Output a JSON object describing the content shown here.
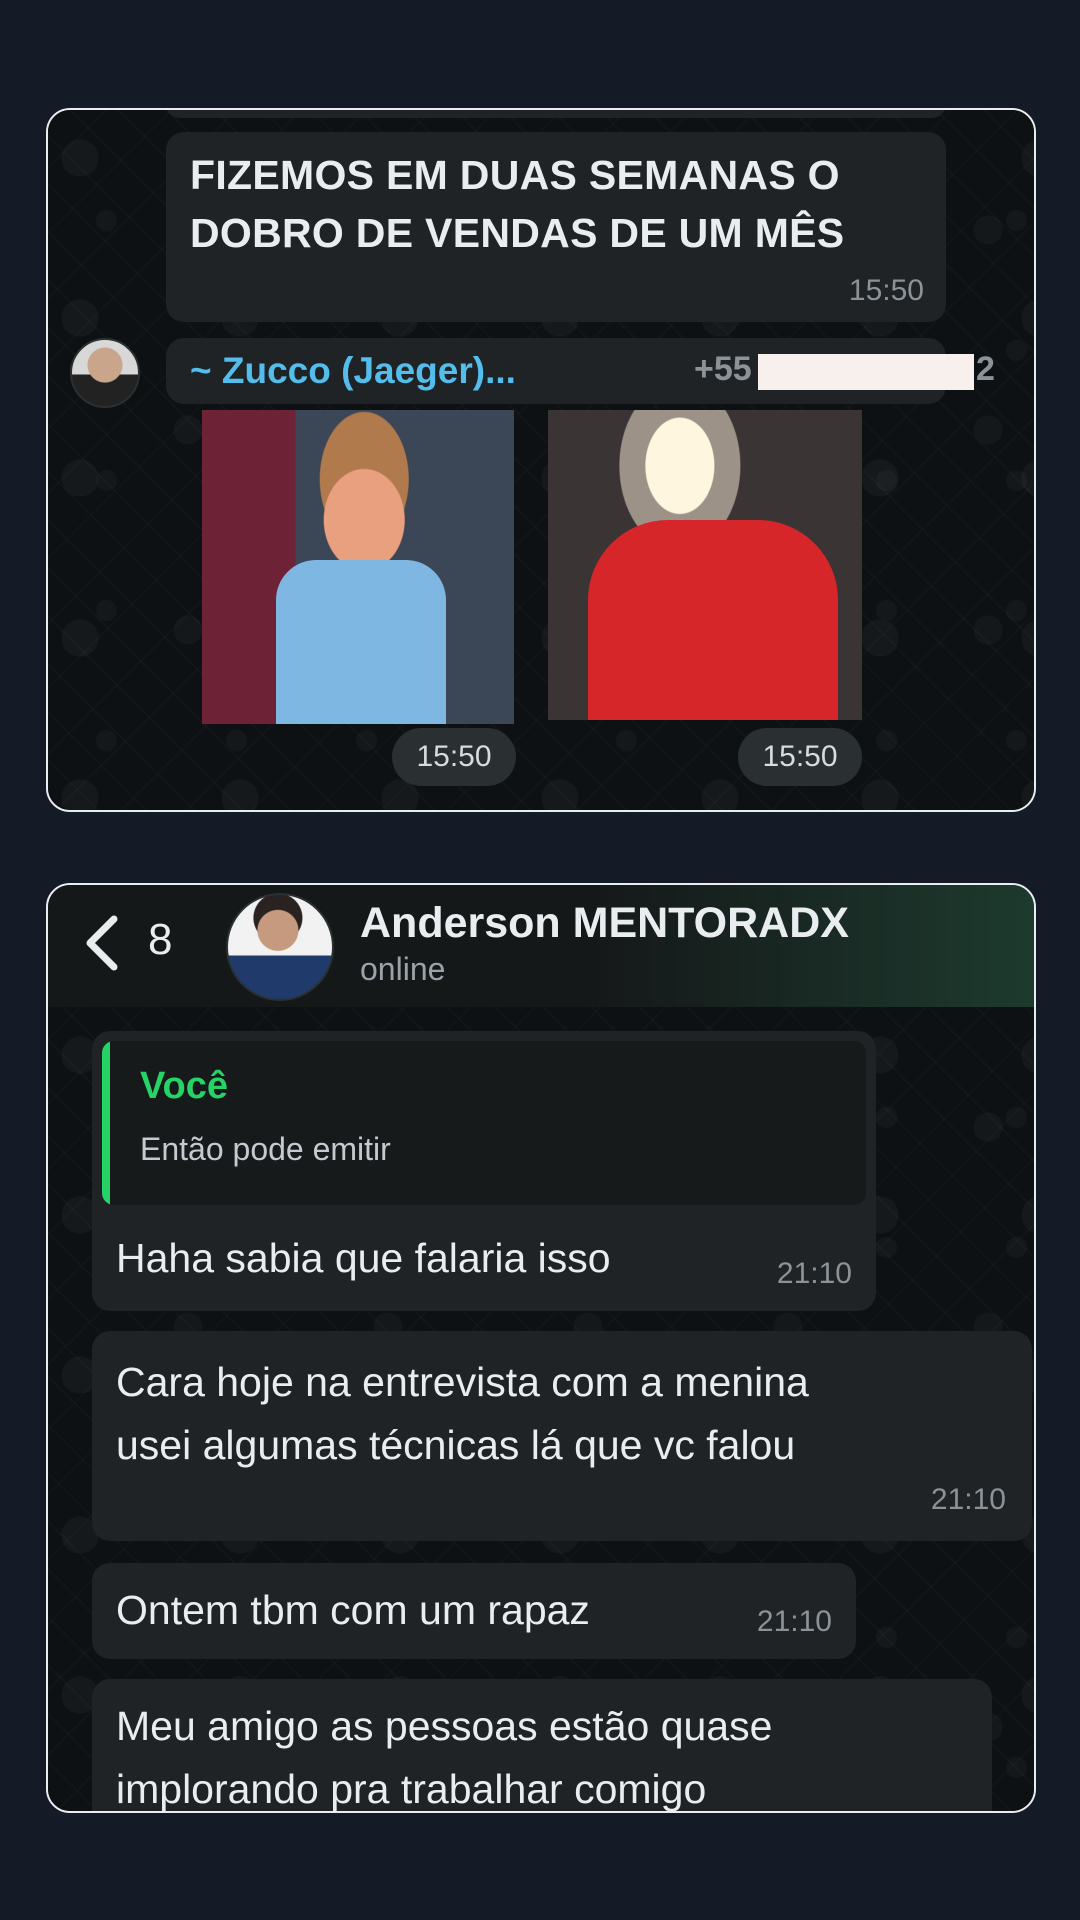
{
  "screenshot1": {
    "message": {
      "line1": "FIZEMOS EM DUAS SEMANAS O",
      "line2": "DOBRO DE VENDAS DE UM MÊS",
      "time": "15:50"
    },
    "sender": {
      "name": "~ Zucco (Jaeger)...",
      "phone_prefix": "+55",
      "phone_suffix": "2"
    },
    "stickers": [
      {
        "icon": "sticker-excited-kid",
        "time": "15:50"
      },
      {
        "icon": "sticker-celebrating-player",
        "time": "15:50"
      }
    ]
  },
  "screenshot2": {
    "header": {
      "back_count": "8",
      "contact_name": "Anderson MENTORADX",
      "status": "online"
    },
    "messages": [
      {
        "quote_author": "Você",
        "quote_text": "Então pode emitir",
        "text": "Haha sabia que falaria isso",
        "time": "21:10"
      },
      {
        "line1": "Cara hoje na entrevista com a menina",
        "line2": "usei algumas técnicas lá que vc falou",
        "time": "21:10"
      },
      {
        "text": "Ontem tbm com um rapaz",
        "time": "21:10"
      },
      {
        "line1": "Meu amigo as pessoas estão quase",
        "line2": "implorando pra trabalhar comigo"
      }
    ]
  },
  "colors": {
    "page_background": "#141a26",
    "bubble": "#1f2325",
    "sender_name": "#53bdeb",
    "quote_accent": "#25d366"
  }
}
